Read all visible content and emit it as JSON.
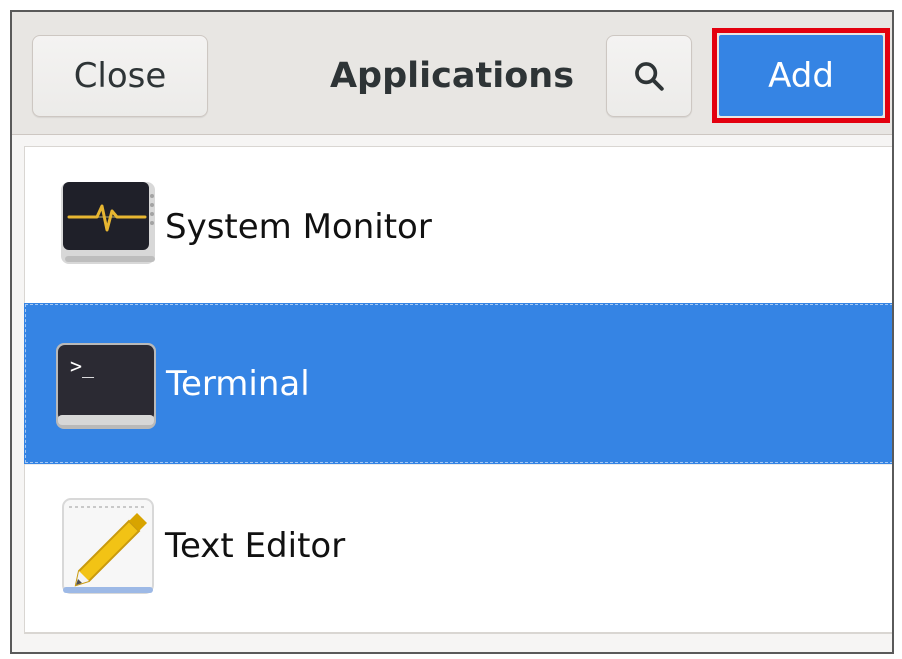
{
  "header": {
    "close_label": "Close",
    "title": "Applications",
    "search_icon": "search-icon",
    "add_label": "Add"
  },
  "apps": [
    {
      "label": "System Monitor",
      "icon": "system-monitor-icon",
      "selected": false
    },
    {
      "label": "Terminal",
      "icon": "terminal-icon",
      "selected": true
    },
    {
      "label": "Text Editor",
      "icon": "text-editor-icon",
      "selected": false
    }
  ],
  "colors": {
    "accent": "#3584e4",
    "highlight_border": "#e3000f"
  }
}
